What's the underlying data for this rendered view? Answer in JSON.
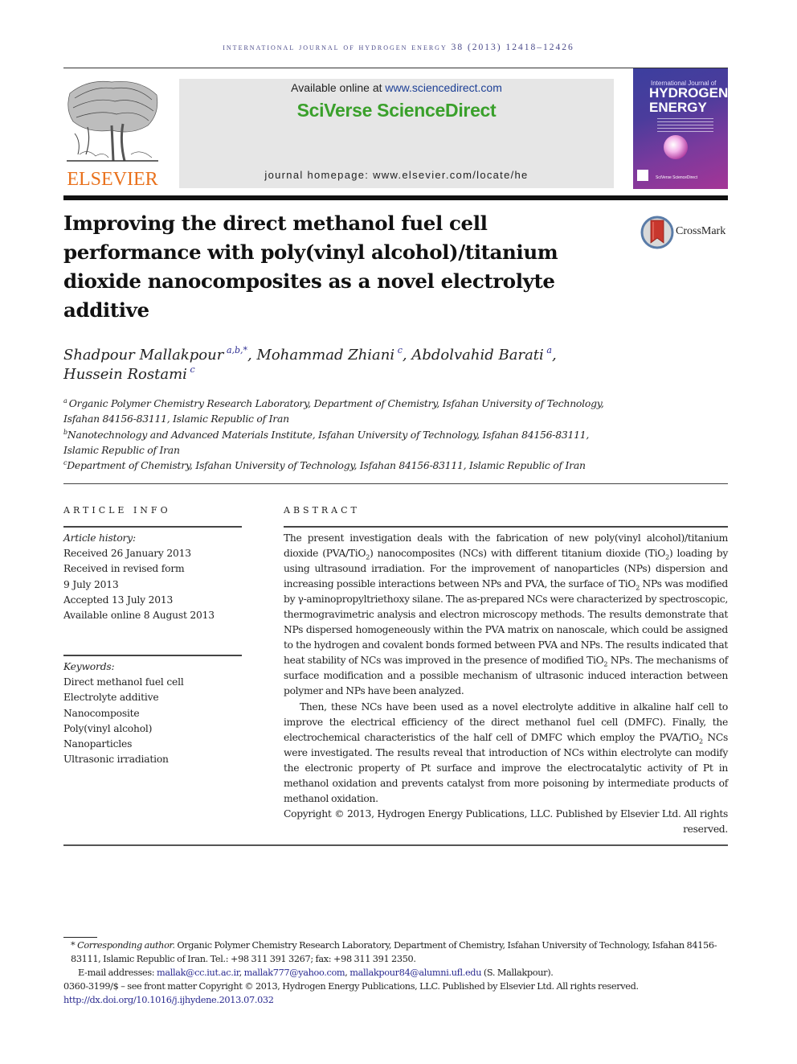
{
  "running_head": "INTERNATIONAL JOURNAL OF HYDROGEN ENERGY 38 (2013) 12418–12426",
  "header": {
    "publisher_logo_text": "ELSEVIER",
    "available_prefix": "Available online at ",
    "available_link": "www.sciencedirect.com",
    "platform_name": "SciVerse ScienceDirect",
    "homepage_prefix": "journal homepage: ",
    "homepage_url": "www.elsevier.com/locate/he",
    "cover": {
      "line1": "International Journal of",
      "line2": "HYDROGEN",
      "line3": "ENERGY",
      "footer": "SciVerse ScienceDirect"
    },
    "colors": {
      "elsevier_orange": "#e9711c",
      "sciverse_green": "#3aa02b",
      "link_blue": "#1c3f95",
      "banner_gray": "#e6e6e6"
    }
  },
  "article": {
    "title": "Improving the direct methanol fuel cell performance with poly(vinyl alcohol)/titanium dioxide nanocomposites as a novel electrolyte additive",
    "title_lines": [
      "Improving the direct methanol fuel cell",
      "performance with poly(vinyl alcohol)/titanium",
      "dioxide nanocomposites as a novel electrolyte",
      "additive"
    ],
    "crossmark_label": "CrossMark",
    "authors": [
      {
        "name": "Shadpour Mallakpour",
        "sup": "a,b,*",
        "sep": ", "
      },
      {
        "name": "Mohammad Zhiani",
        "sup": "c",
        "sep": ", "
      },
      {
        "name": "Abdolvahid Barati",
        "sup": "a",
        "sep": ","
      },
      {
        "name": "Hussein Rostami",
        "sup": "c",
        "sep": ""
      }
    ],
    "affiliations": [
      {
        "mark": "a",
        "line1": "Organic Polymer Chemistry Research Laboratory, Department of Chemistry, Isfahan University of Technology,",
        "line2": "Isfahan 84156-83111, Islamic Republic of Iran"
      },
      {
        "mark": "b",
        "line1": "Nanotechnology and Advanced Materials Institute, Isfahan University of Technology, Isfahan 84156-83111,",
        "line2": "Islamic Republic of Iran"
      },
      {
        "mark": "c",
        "line1": "Department of Chemistry, Isfahan University of Technology, Isfahan 84156-83111, Islamic Republic of Iran",
        "line2": ""
      }
    ]
  },
  "article_info": {
    "heading": "ARTICLE INFO",
    "history_label": "Article history:",
    "history": [
      "Received 26 January 2013",
      "Received in revised form",
      "9 July 2013",
      "Accepted 13 July 2013",
      "Available online 8 August 2013"
    ],
    "keywords_label": "Keywords:",
    "keywords": [
      "Direct methanol fuel cell",
      "Electrolyte additive",
      "Nanocomposite",
      "Poly(vinyl alcohol)",
      "Nanoparticles",
      "Ultrasonic irradiation"
    ]
  },
  "abstract": {
    "heading": "ABSTRACT",
    "p1": {
      "a": "The present investigation deals with the fabrication of new poly(vinyl alcohol)/titanium dioxide (PVA/TiO",
      "b": ") nanocomposites (NCs) with different titanium dioxide (TiO",
      "c": ") loading by using ultrasound irradiation. For the improvement of nanoparticles (NPs) dispersion and increasing possible interactions between NPs and PVA, the surface of TiO",
      "d": " NPs was modified by γ-aminopropyltriethoxy silane. The as-prepared NCs were characterized by spectroscopic, thermogravimetric analysis and electron microscopy methods. The results demonstrate that NPs dispersed homogeneously within the PVA matrix on nanoscale, which could be assigned to the hydrogen and covalent bonds formed between PVA and NPs. The results indicated that heat stability of NCs was improved in the presence of modified TiO",
      "e": " NPs. The mechanisms of surface modification and a possible mechanism of ultrasonic induced interaction between polymer and NPs have been analyzed."
    },
    "p2": {
      "a": "Then, these NCs have been used as a novel electrolyte additive in alkaline half cell to improve the electrical efficiency of the direct methanol fuel cell (DMFC). Finally, the electrochemical characteristics of the half cell of DMFC which employ the PVA/TiO",
      "b": " NCs were investigated. The results reveal that introduction of NCs within electrolyte can modify the electronic property of Pt surface and improve the electrocatalytic activity of Pt in methanol oxidation and prevents catalyst from more poisoning by intermediate products of methanol oxidation."
    },
    "subscript": "2",
    "copyright": "Copyright © 2013, Hydrogen Energy Publications, LLC. Published by Elsevier Ltd. All rights reserved."
  },
  "footnotes": {
    "corresponding_mark": "*",
    "corresponding_label": "Corresponding author.",
    "corresponding_text": " Organic Polymer Chemistry Research Laboratory, Department of Chemistry, Isfahan University of Technology, Isfahan 84156-83111, Islamic Republic of Iran. Tel.: +98 311 391 3267; fax: +98 311 391 2350.",
    "email_label": "E-mail addresses: ",
    "emails": [
      "mallak@cc.iut.ac.ir",
      "mallak777@yahoo.com",
      "mallakpour84@alumni.ufl.edu"
    ],
    "email_owner": " (S. Mallakpour).",
    "issn_line": "0360-3199/$ – see front matter Copyright © 2013, Hydrogen Energy Publications, LLC. Published by Elsevier Ltd. All rights reserved.",
    "doi": "http://dx.doi.org/10.1016/j.ijhydene.2013.07.032"
  }
}
